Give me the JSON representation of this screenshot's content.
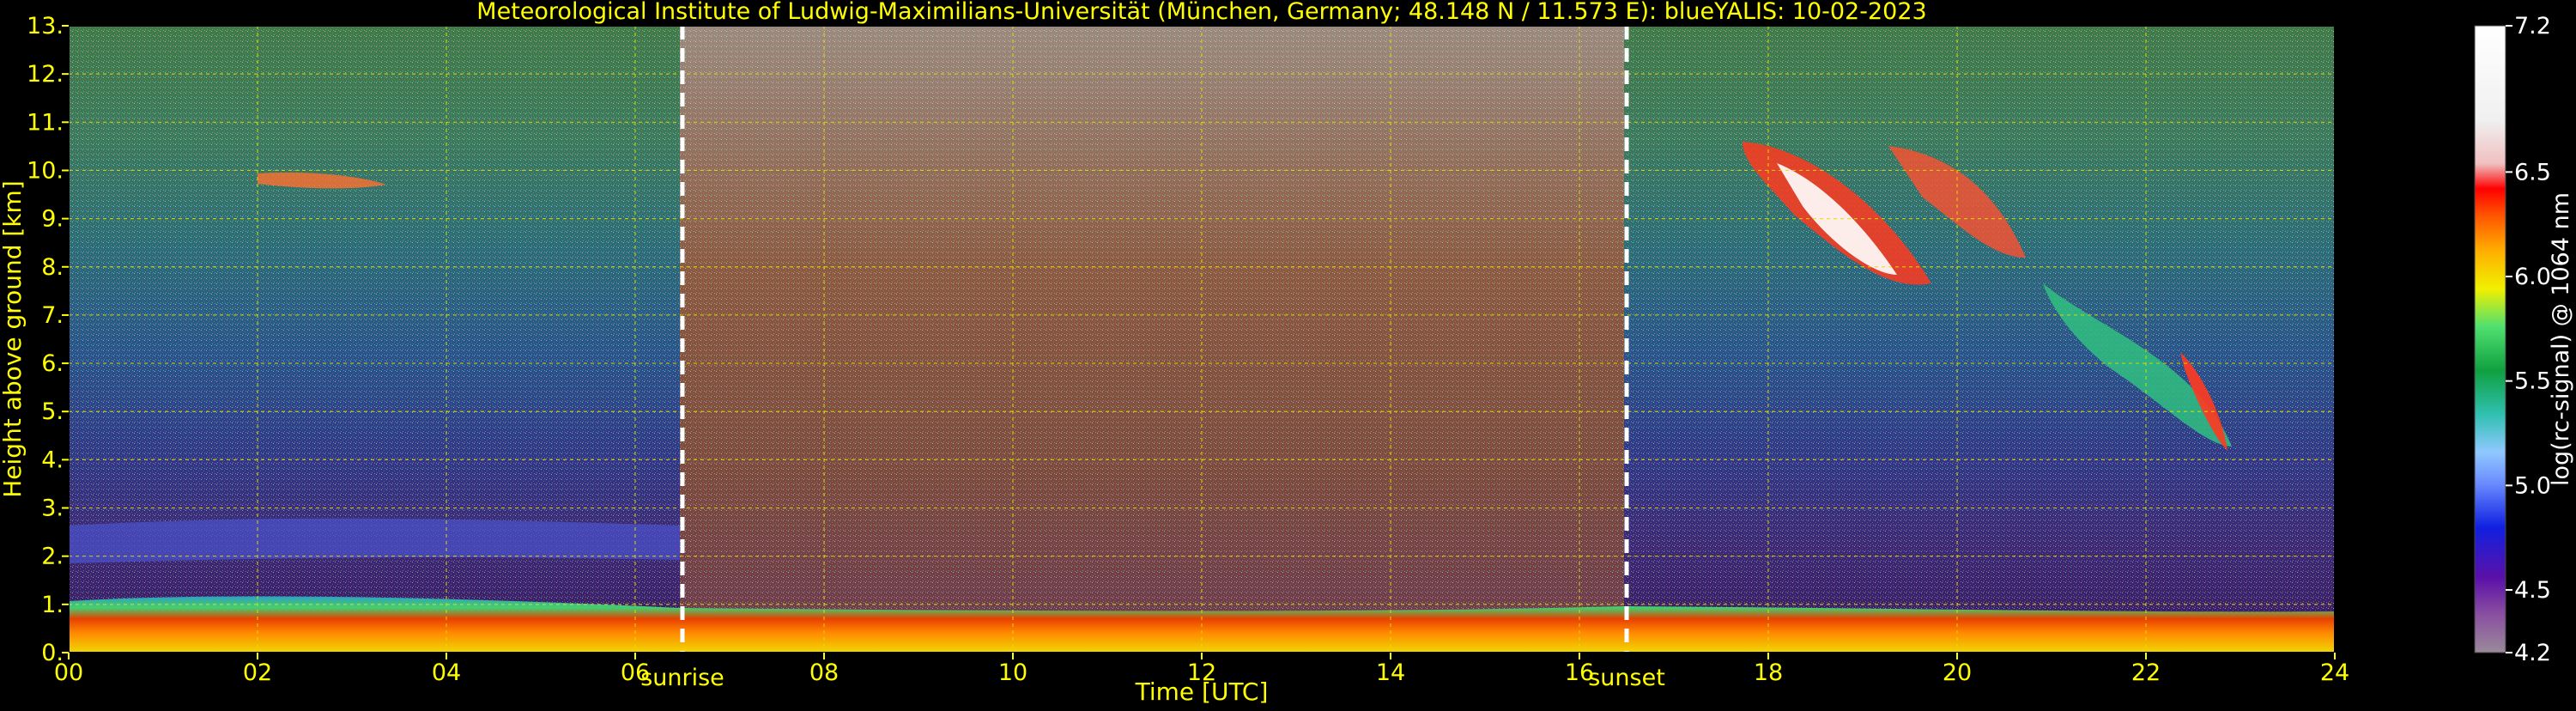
{
  "chart_data": {
    "type": "heatmap",
    "title": "Meteorological Institute of Ludwig-Maximilians-Universität (München, Germany; 48.148 N / 11.573 E):     blueYALIS: 10-02-2023",
    "xlabel": "Time [UTC]",
    "ylabel": "Height above ground [km]",
    "xlim": [
      0,
      24
    ],
    "ylim": [
      0,
      13
    ],
    "x_ticks": [
      "00",
      "02",
      "04",
      "06",
      "08",
      "10",
      "12",
      "14",
      "16",
      "18",
      "20",
      "22",
      "24"
    ],
    "y_ticks": [
      "0.",
      "1.",
      "2.",
      "3.",
      "4.",
      "5.",
      "6.",
      "7.",
      "8.",
      "9.",
      "10.",
      "11.",
      "12.",
      "13."
    ],
    "grid": true,
    "colorbar": {
      "label": "log(rc-signal) @ 1064 nm",
      "range": [
        4.2,
        7.2
      ],
      "ticks": [
        "4.2",
        "4.5",
        "5.0",
        "5.5",
        "6.0",
        "6.5",
        "7.2"
      ],
      "tick_values": [
        4.2,
        4.5,
        5.0,
        5.5,
        6.0,
        6.5,
        7.2
      ]
    },
    "annotations": [
      {
        "label": "sunrise",
        "x": 6.5
      },
      {
        "label": "sunset",
        "x": 16.5
      }
    ],
    "features": {
      "boundary_layer_top_km": 1.0,
      "residual_layer_km": [
        2.0,
        2.7
      ],
      "cirrus_cloud_time": [
        17.5,
        22.5
      ],
      "cirrus_cloud_height_km": [
        4.0,
        10.7
      ],
      "noise_dominated_period": [
        6.5,
        16.5
      ]
    }
  }
}
